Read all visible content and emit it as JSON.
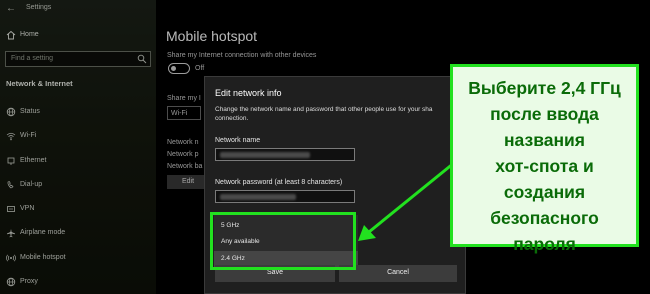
{
  "window": {
    "app_title": "Settings"
  },
  "sidebar": {
    "home_label": "Home",
    "search_placeholder": "Find a setting",
    "section_title": "Network & Internet",
    "items": [
      {
        "label": "Status",
        "icon": "globe-icon"
      },
      {
        "label": "Wi-Fi",
        "icon": "wifi-icon"
      },
      {
        "label": "Ethernet",
        "icon": "ethernet-icon"
      },
      {
        "label": "Dial-up",
        "icon": "phone-icon"
      },
      {
        "label": "VPN",
        "icon": "vpn-icon"
      },
      {
        "label": "Airplane mode",
        "icon": "airplane-icon"
      },
      {
        "label": "Mobile hotspot",
        "icon": "hotspot-icon"
      },
      {
        "label": "Proxy",
        "icon": "globe-icon"
      }
    ]
  },
  "main": {
    "title": "Mobile hotspot",
    "share_label": "Share my Internet connection with other devices",
    "toggle_state": "Off",
    "share_from_label": "Share my I",
    "share_from_value": "Wi-Fi",
    "info_lines": [
      "Network n",
      "Network p",
      "Network ba"
    ],
    "edit_label": "Edit"
  },
  "dialog": {
    "title": "Edit network info",
    "description": "Change the network name and password that other people use for your sha connection.",
    "network_name_label": "Network name",
    "password_label": "Network password (at least 8 characters)",
    "band_options": [
      "5 GHz",
      "Any available",
      "2.4 GHz"
    ],
    "selected_band": "2.4 GHz",
    "save_label": "Save",
    "cancel_label": "Cancel"
  },
  "annotation": {
    "callout_text": "Выберите 2,4 ГГц\nпосле ввода\nназвания\nхот-спота и\nсоздания\nбезопасного\nпароля",
    "color": "#22e11f"
  }
}
